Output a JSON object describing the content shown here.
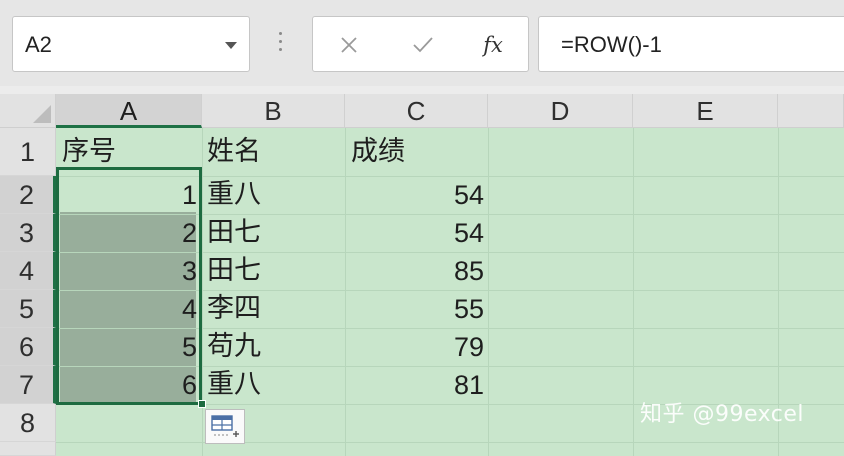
{
  "formula_bar": {
    "name_box": "A2",
    "cancel_icon": "cancel-x-icon",
    "enter_icon": "check-icon",
    "fx_label": "fx",
    "formula": "=ROW()-1"
  },
  "columns": [
    "A",
    "B",
    "C",
    "D",
    "E"
  ],
  "rows": [
    "1",
    "2",
    "3",
    "4",
    "5",
    "6",
    "7",
    "8"
  ],
  "headers": {
    "a": "序号",
    "b": "姓名",
    "c": "成绩"
  },
  "data": [
    {
      "num": "1",
      "name": "重八",
      "score": "54"
    },
    {
      "num": "2",
      "name": "田七",
      "score": "54"
    },
    {
      "num": "3",
      "name": "田七",
      "score": "85"
    },
    {
      "num": "4",
      "name": "李四",
      "score": "55"
    },
    {
      "num": "5",
      "name": "苟九",
      "score": "79"
    },
    {
      "num": "6",
      "name": "重八",
      "score": "81"
    }
  ],
  "watermark": "知乎 @99excel",
  "colors": {
    "cell_bg": "#c9e6cc",
    "selection_border": "#1d6b40",
    "selection_fill": "#98ae9b"
  }
}
